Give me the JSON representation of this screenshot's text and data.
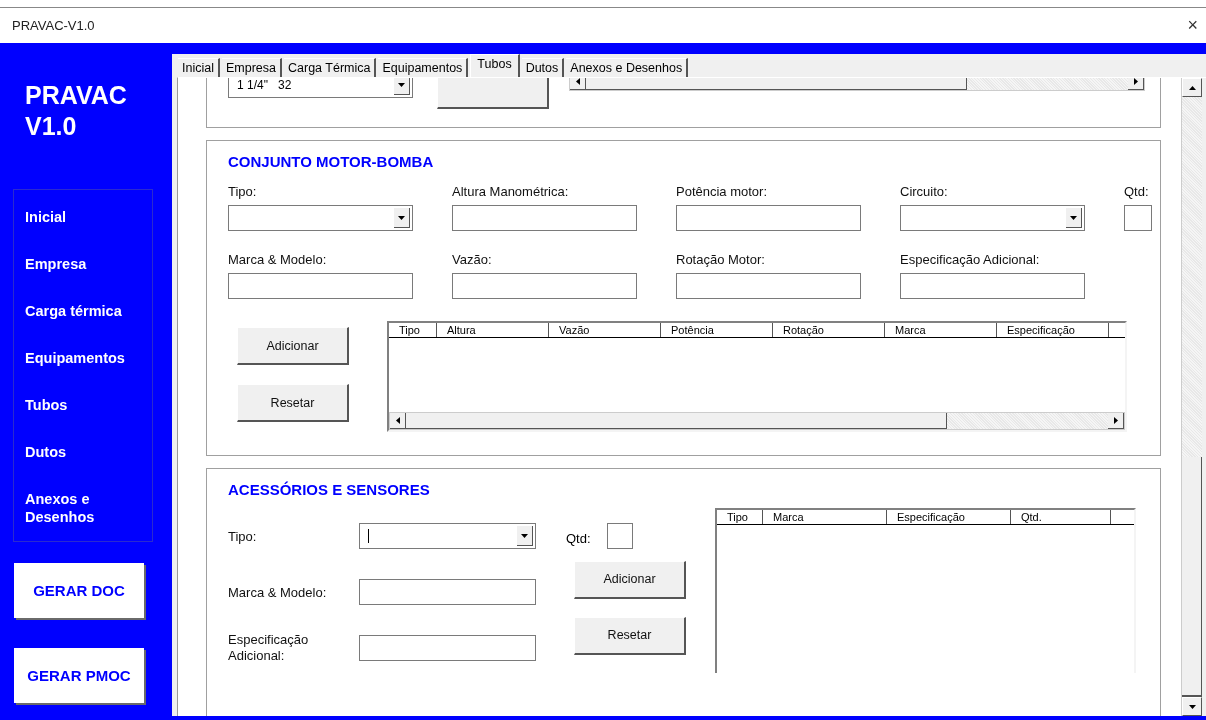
{
  "window": {
    "title": "PRAVAC-V1.0",
    "close": "×"
  },
  "sidebar": {
    "title": "PRAVAC V1.0",
    "items": [
      {
        "label": "Inicial"
      },
      {
        "label": "Empresa"
      },
      {
        "label": "Carga térmica"
      },
      {
        "label": "Equipamentos"
      },
      {
        "label": "Tubos"
      },
      {
        "label": "Dutos"
      },
      {
        "label": "Anexos e Desenhos"
      }
    ],
    "buttons": [
      "GERAR DOC",
      "GERAR PMOC"
    ]
  },
  "tabs": [
    {
      "label": "Inicial",
      "selected": false
    },
    {
      "label": "Empresa",
      "selected": false
    },
    {
      "label": "Carga Térmica",
      "selected": false
    },
    {
      "label": "Equipamentos",
      "selected": false
    },
    {
      "label": "Tubos",
      "selected": true
    },
    {
      "label": "Dutos",
      "selected": false
    },
    {
      "label": "Anexos e Desenhos",
      "selected": false
    }
  ],
  "top_section": {
    "combo_value": "1 1/4\"   32"
  },
  "pump_section": {
    "title": "CONJUNTO MOTOR-BOMBA",
    "rows": [
      [
        {
          "label": "Tipo:",
          "kind": "combo"
        },
        {
          "label": "Altura Manométrica:",
          "kind": "text"
        },
        {
          "label": "Potência motor:",
          "kind": "text"
        },
        {
          "label": "Circuito:",
          "kind": "combo"
        },
        {
          "label": "Qtd:",
          "kind": "short"
        }
      ],
      [
        {
          "label": "Marca & Modelo:",
          "kind": "text"
        },
        {
          "label": "Vazão:",
          "kind": "text"
        },
        {
          "label": "Rotação Motor:",
          "kind": "text"
        },
        {
          "label": "Especificação Adicional:",
          "kind": "text"
        }
      ]
    ],
    "buttons": [
      "Adicionar",
      "Resetar"
    ],
    "table": {
      "columns": [
        "Tipo",
        "Altura",
        "Vazão",
        "Potência",
        "Rotação",
        "Marca",
        "Especificação"
      ]
    }
  },
  "accessories_section": {
    "title": "ACESSÓRIOS E SENSORES",
    "tipo": {
      "label": "Tipo:"
    },
    "qtd": {
      "label": "Qtd:"
    },
    "marca": {
      "label": "Marca & Modelo:"
    },
    "spec": {
      "label": "Especificação Adicional:"
    },
    "buttons": [
      "Adicionar",
      "Resetar"
    ],
    "table": {
      "columns": [
        "Tipo",
        "Marca",
        "Especificação",
        "Qtd."
      ]
    }
  }
}
